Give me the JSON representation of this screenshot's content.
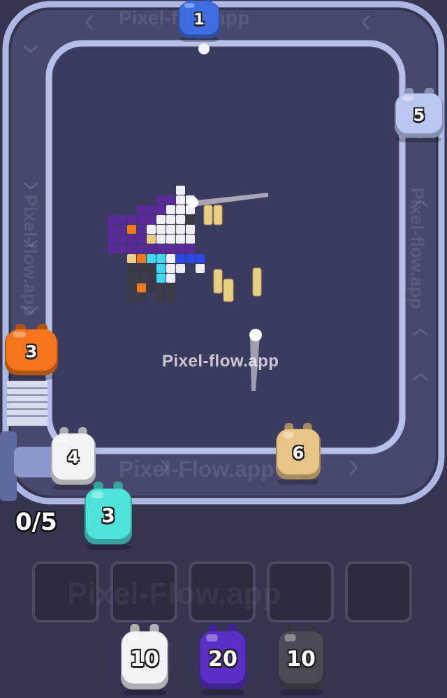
{
  "watermark": {
    "center_text": "Pixel-flow.app",
    "top_text": "Pixel-flow.app",
    "bottom_track_text": "Pixel-Flow.app",
    "slots_text": "Pixel-Flow.app",
    "side_text": "Pixel-flow.app"
  },
  "progress_counter": "0/5",
  "shooters_on_track": [
    {
      "label": "1",
      "color": "#3f6de0",
      "name": "blue-shooter"
    },
    {
      "label": "5",
      "color": "#b9c6f2",
      "name": "lavender-shooter"
    },
    {
      "label": "3",
      "color": "#f5741d",
      "name": "orange-shooter"
    },
    {
      "label": "6",
      "color": "#e8c486",
      "name": "tan-shooter"
    }
  ],
  "queue_shooters": [
    {
      "label": "4",
      "color": "#f2f3f7",
      "name": "white-shooter"
    },
    {
      "label": "3",
      "color": "#4fe4db",
      "name": "cyan-shooter"
    }
  ],
  "holding_slots": [
    "",
    "",
    "",
    "",
    ""
  ],
  "reserve_shooters": [
    {
      "label": "10",
      "color": "#f2f3f7",
      "name": "white-reserve-shooter"
    },
    {
      "label": "20",
      "color": "#5a2fc8",
      "name": "purple-reserve-shooter"
    },
    {
      "label": "10",
      "color": "#4a4a55",
      "name": "dark-reserve-shooter"
    }
  ],
  "colors": {
    "background": "#353552",
    "board": "#3a3a5e",
    "track": "#a9b3dd",
    "pixel_purple": "#5a2a9a",
    "pixel_dark": "#3a3a44",
    "pixel_white": "#eeeef4",
    "pixel_cyan": "#3fd8f0",
    "pixel_blue": "#2a48e6",
    "pixel_orange": "#f07a1a",
    "pixel_tan": "#e9cf84"
  }
}
